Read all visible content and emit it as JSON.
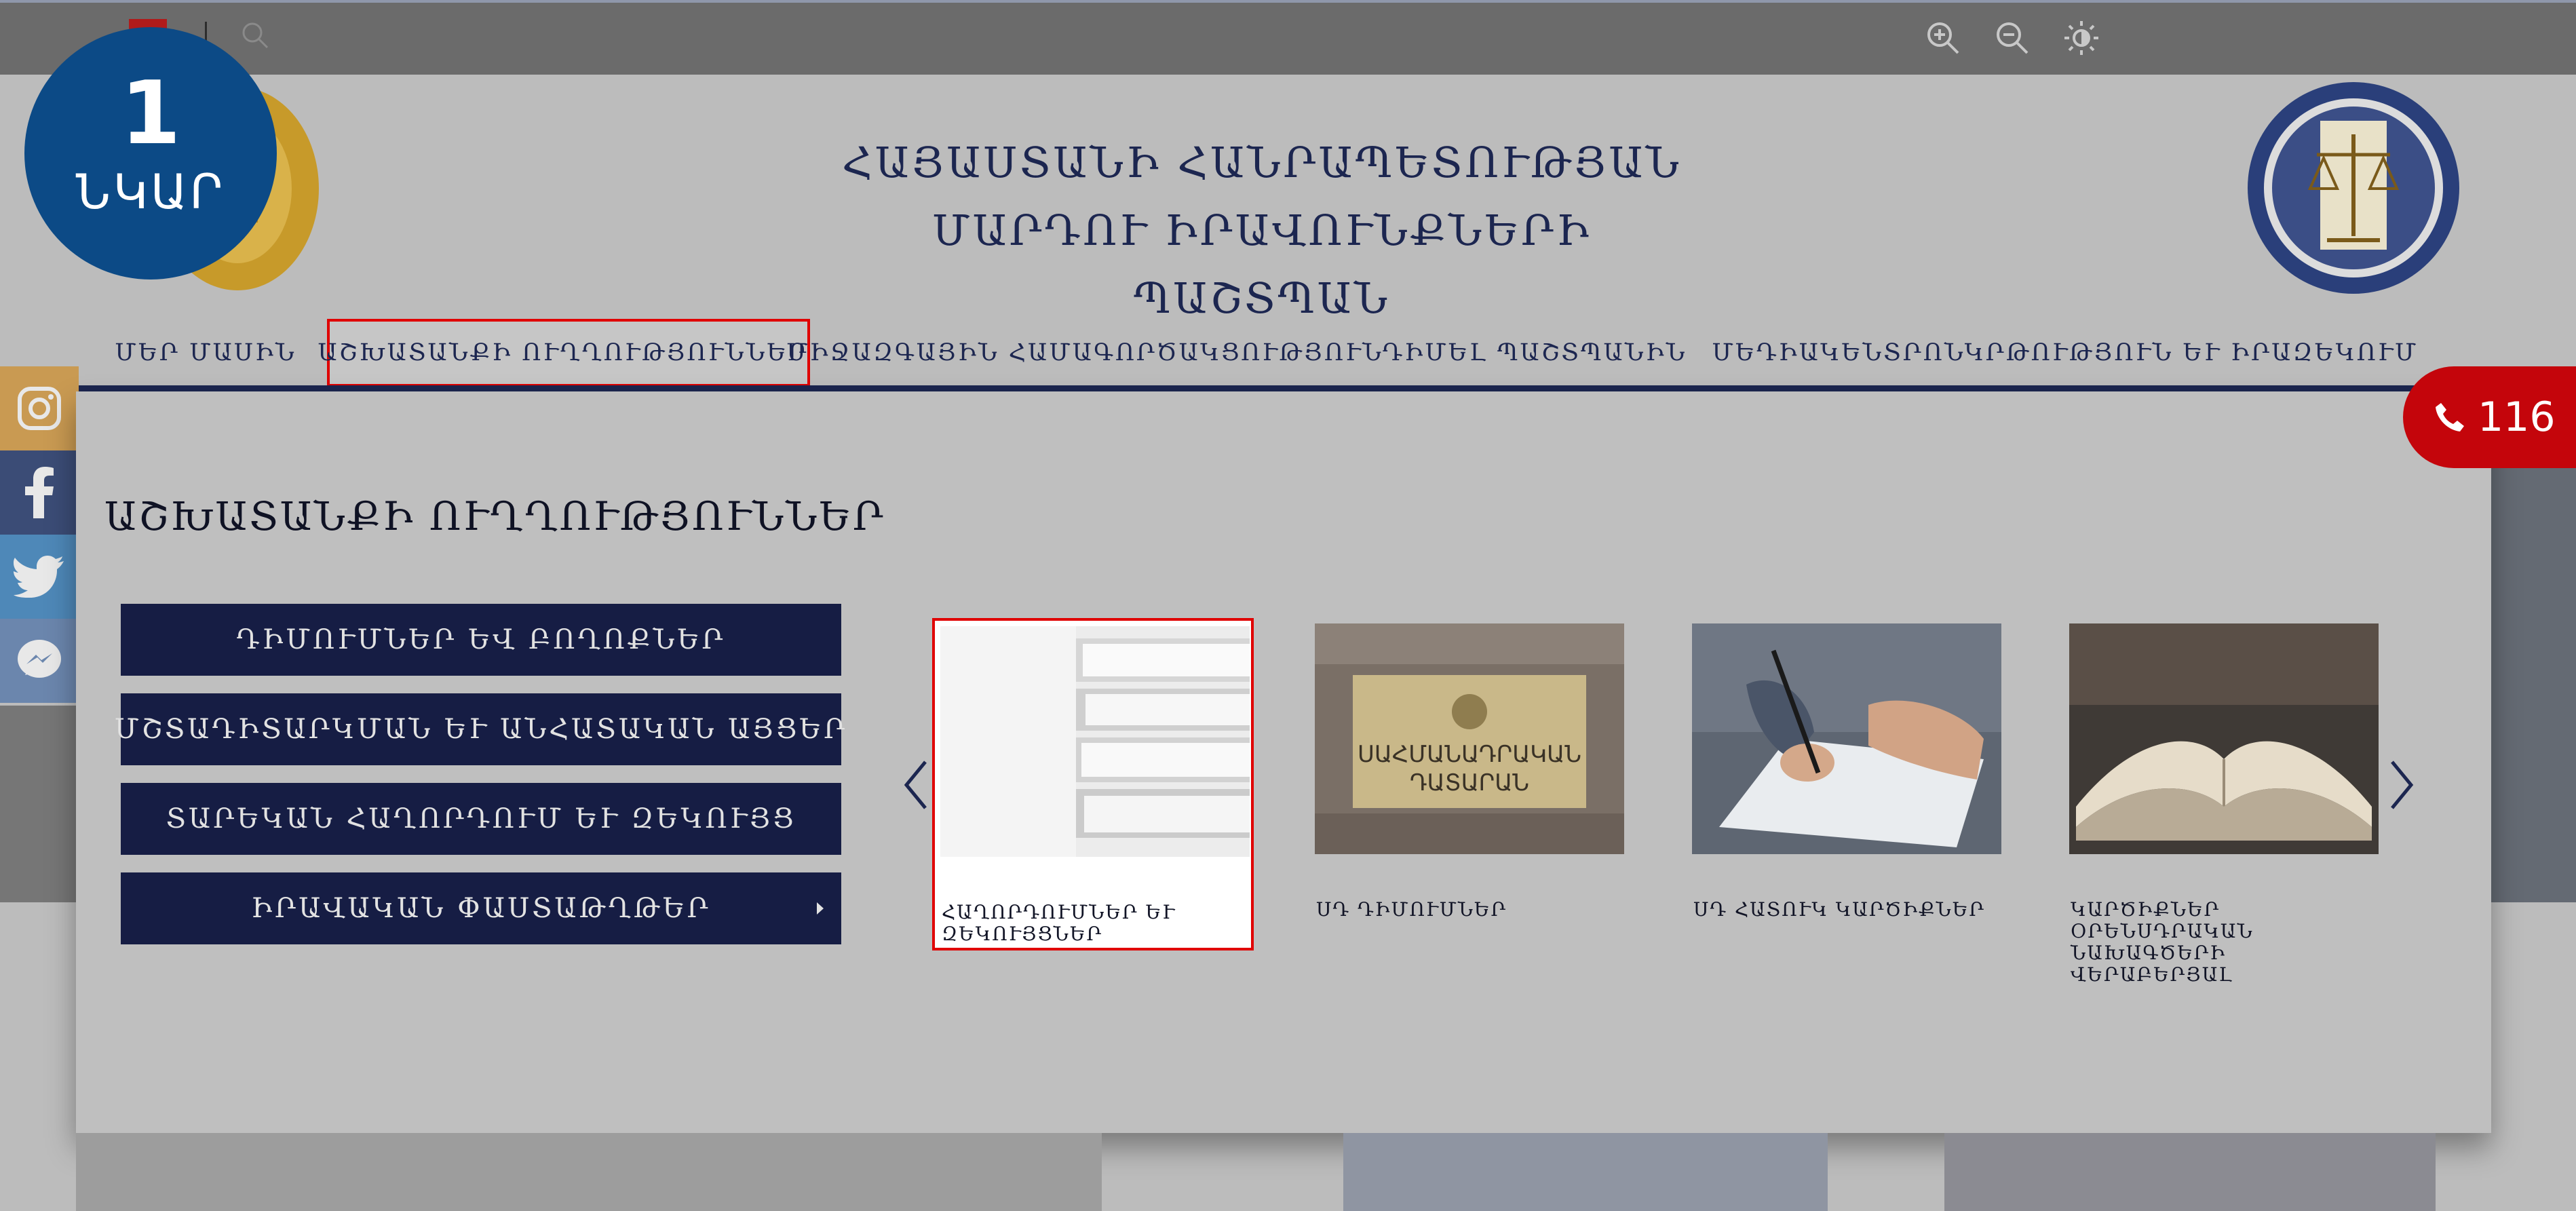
{
  "badge": {
    "number": "1",
    "word": "ՆԿԱՐ"
  },
  "site": {
    "title_line1": "ՀԱՅԱՍՏԱՆԻ ՀԱՆՐԱՊԵՏՈՒԹՅԱՆ",
    "title_line2": "ՄԱՐԴՈՒ ԻՐԱՎՈՒՆՔՆԵՐԻ ՊԱՇՏՊԱՆ"
  },
  "topbar": {
    "icons": [
      "search-icon",
      "zoom-in-icon",
      "zoom-out-icon",
      "contrast-icon"
    ]
  },
  "nav": {
    "items": [
      {
        "label": "ՄԵՐ ՄԱՍԻՆ"
      },
      {
        "label": "ԱՇԽԱՏԱՆՔԻ ՈՒՂՂՈՒԹՅՈՒՆՆԵՐ"
      },
      {
        "label": "ՄԻՋԱԶԳԱՅԻՆ ՀԱՄԱԳՈՐԾԱԿՑՈՒԹՅՈՒՆ"
      },
      {
        "label": "ԴԻՄԵԼ ՊԱՇՏՊԱՆԻՆ"
      },
      {
        "label": "ՄԵԴԻԱԿԵՆՏՐՈՆ"
      },
      {
        "label": "ԿՐԹՈՒԹՅՈՒՆ ԵՒ ԻՐԱԶԵԿՈՒՄ"
      }
    ]
  },
  "hotline": {
    "number": "116"
  },
  "dropdown": {
    "title": "ԱՇԽԱՏԱՆՔԻ ՈՒՂՂՈՒԹՅՈՒՆՆԵՐ",
    "buttons": [
      {
        "label": "ԴԻՄՈՒՄՆԵՐ ԵՎ ԲՈՂՈՔՆԵՐ"
      },
      {
        "label": "ՄՇՏԱԴԻՏԱՐԿՄԱՆ ԵՒ ԱՆՀԱՏԱԿԱՆ ԱՅՑԵՐ"
      },
      {
        "label": "ՏԱՐԵԿԱՆ ՀԱՂՈՐԴՈՒՄ ԵՒ ԶԵԿՈՒՅՑ"
      },
      {
        "label": "ԻՐԱՎԱԿԱՆ ՓԱՍՏԱԹՂԹԵՐ"
      }
    ],
    "cards": [
      {
        "label": "ՀԱՂՈՐԴՈՒՄՆԵՐ ԵՒ ԶԵԿՈՒՅՑՆԵՐ"
      },
      {
        "label": "ՍԴ ԴԻՄՈՒՄՆԵՐ",
        "sign_line1": "ՍԱՀՄԱՆԱԴՐԱԿԱՆ",
        "sign_line2": "ԴԱՏԱՐԱՆ"
      },
      {
        "label": "ՍԴ ՀԱՏՈՒԿ ԿԱՐԾԻՔՆԵՐ"
      },
      {
        "label": "ԿԱՐԾԻՔՆԵՐ ՕՐԵՆՍԴՐԱԿԱՆ ՆԱԽԱԳԾԵՐԻ ՎԵՐԱԲԵՐՅԱԼ"
      }
    ]
  },
  "social": [
    "instagram-icon",
    "facebook-icon",
    "twitter-icon",
    "messenger-icon"
  ],
  "colors": {
    "navy": "#1c2650",
    "button_bg": "#161d44",
    "badge_blue": "#0c4a86",
    "hotline_red": "#c4050b",
    "highlight_red": "#e00000"
  }
}
